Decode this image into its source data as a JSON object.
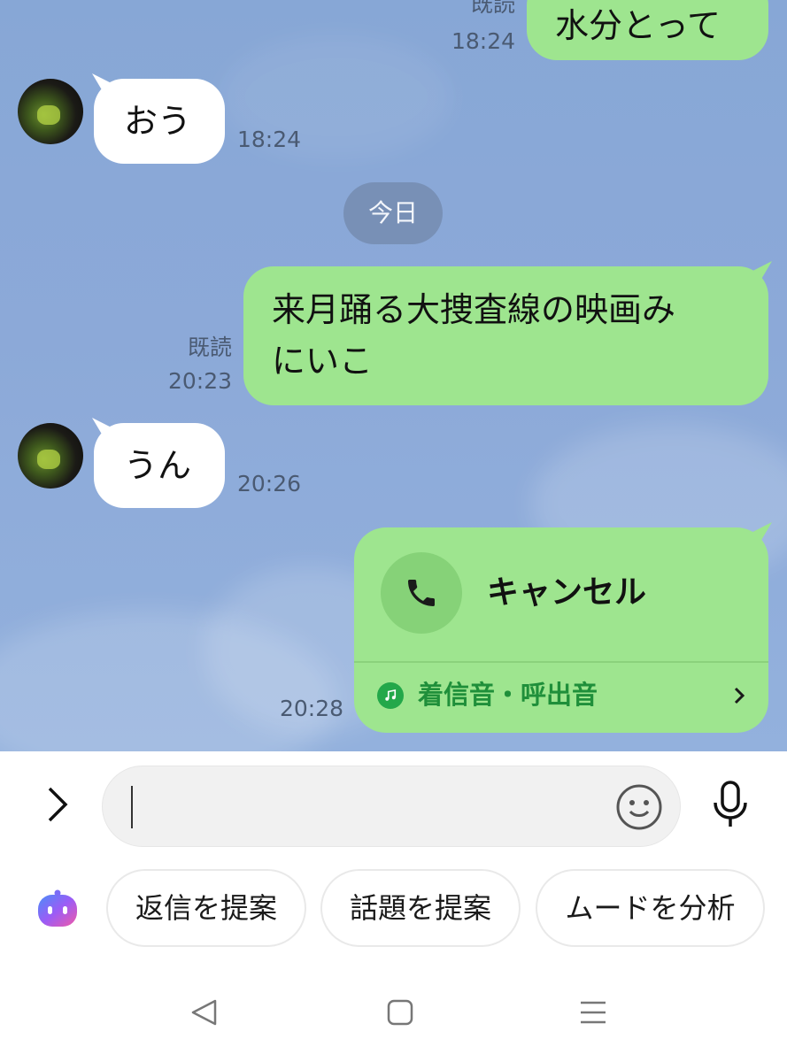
{
  "messages": [
    {
      "id": "m1",
      "side": "out",
      "text": "水分とって",
      "read": "既読",
      "time": "18:24"
    },
    {
      "id": "m2",
      "side": "in",
      "text": "おう",
      "time": "18:24"
    },
    {
      "id": "m3",
      "side": "out",
      "lines": [
        "来月踊る大捜査線の映画み",
        "にいこ"
      ],
      "read": "既読",
      "time": "20:23"
    },
    {
      "id": "m4",
      "side": "in",
      "text": "うん",
      "time": "20:26"
    }
  ],
  "date_separator": "今日",
  "call": {
    "label": "キャンセル",
    "ringtone_label": "着信音・呼出音",
    "time": "20:28"
  },
  "input": {
    "placeholder": ""
  },
  "suggestions": [
    "返信を提案",
    "話題を提案",
    "ムードを分析"
  ],
  "icons": {
    "expand": "chevron-right-icon",
    "emoji": "smiley-icon",
    "mic": "microphone-icon",
    "ai": "ai-assistant-icon",
    "call": "phone-icon",
    "ringtone": "music-note-icon",
    "back": "back-triangle-icon",
    "home": "home-square-icon",
    "recents": "menu-lines-icon"
  },
  "colors": {
    "chat_bg": "#8ca9d8",
    "bubble_out": "#9ee58f",
    "bubble_in": "#ffffff",
    "ringtone_green": "#1f8f3a",
    "date_pill": "#7890b6"
  }
}
